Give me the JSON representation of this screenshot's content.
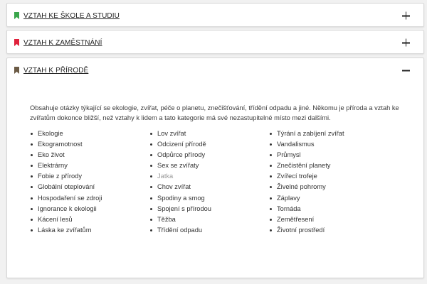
{
  "sections": [
    {
      "title": "Vztah ke škole a studiu",
      "marker_color": "#3aa64b",
      "toggle": "+"
    },
    {
      "title": "Vztah k zaměstnání",
      "marker_color": "#e0213c",
      "toggle": "+"
    },
    {
      "title": "Vztah k přírodě",
      "marker_color": "#6b5a45",
      "toggle": "−"
    }
  ],
  "nature": {
    "description": "Obsahuje otázky týkající se ekologie, zvířat, péče o planetu, znečišťování, třídění odpadu a jiné. Někomu je příroda a vztah ke zvířatům dokonce bližší, než vztahy k lidem a tato kategorie má své nezastupitelné místo mezi dalšími.",
    "columns": [
      [
        "Ekologie",
        "Ekogramotnost",
        "Eko život",
        "Elektrárny",
        "Fobie z přírody",
        "Globální oteplování",
        "Hospodaření se zdroji",
        "Ignorance k ekologii",
        "Kácení lesů",
        "Láska ke zvířatům"
      ],
      [
        "Lov zvířat",
        "Odcizení přírodě",
        "Odpůrce přírody",
        "Sex se zvířaty",
        "Jatka",
        "Chov zvířat",
        "Spodiny a smog",
        "Spojení s přírodou",
        "Těžba",
        "Třídění odpadu"
      ],
      [
        "Týrání a zabíjení zvířat",
        "Vandalismus",
        "Průmysl",
        "Znečistění planety",
        "Zvířecí trofeje",
        "Živelné pohromy",
        "Záplavy",
        "Tornáda",
        "Zemětřesení",
        "Životní prostředí"
      ]
    ],
    "muted_item": "Jatka"
  }
}
